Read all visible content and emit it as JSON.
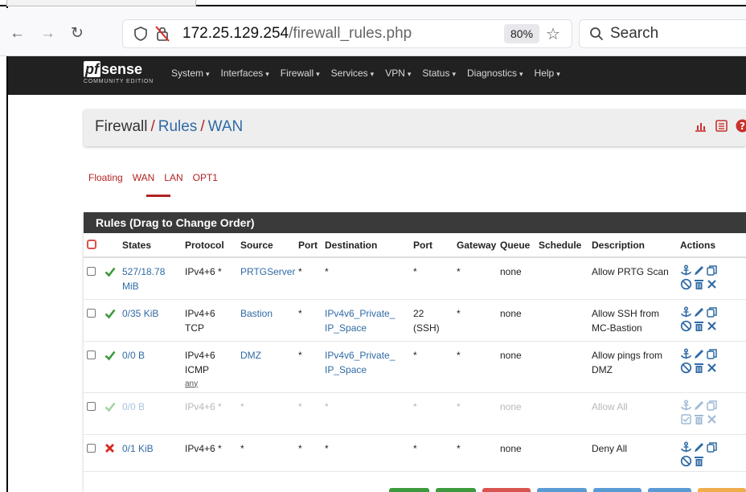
{
  "browser": {
    "url_host": "172.25.129.254",
    "url_path": "/firewall_rules.php",
    "zoom": "80%",
    "search_placeholder": "Search"
  },
  "navbar": {
    "logo_pf": "pf",
    "logo_sense": "sense",
    "logo_edition": "COMMUNITY EDITION",
    "menu": [
      "System",
      "Interfaces",
      "Firewall",
      "Services",
      "VPN",
      "Status",
      "Diagnostics",
      "Help"
    ]
  },
  "breadcrumb": {
    "root": "Firewall",
    "sep1": "/",
    "level2": "Rules",
    "sep2": "/",
    "level3": "WAN"
  },
  "subtabs": [
    "Floating",
    "WAN",
    "LAN",
    "OPT1"
  ],
  "rules": {
    "title": "Rules (Drag to Change Order)",
    "headers": {
      "states": "States",
      "protocol": "Protocol",
      "source": "Source",
      "port": "Port",
      "destination": "Destination",
      "dport": "Port",
      "gateway": "Gateway",
      "queue": "Queue",
      "schedule": "Schedule",
      "description": "Description",
      "actions": "Actions"
    },
    "rows": [
      {
        "states1": "527/18.78",
        "states2": "MiB",
        "proto1": "IPv4+6 *",
        "proto2": "",
        "source": "PRTGServer",
        "sport": "*",
        "dest1": "*",
        "dest2": "",
        "dport1": "*",
        "dport2": "",
        "gateway": "*",
        "queue": "none",
        "schedule": "",
        "desc1": "Allow PRTG Scan",
        "desc2": ""
      },
      {
        "states1": "0/35 KiB",
        "states2": "",
        "proto1": "IPv4+6",
        "proto2": "TCP",
        "source": "Bastion",
        "sport": "*",
        "dest1": "IPv4v6_Private_",
        "dest2": "IP_Space",
        "dport1": "22",
        "dport2": "(SSH)",
        "gateway": "*",
        "queue": "none",
        "schedule": "",
        "desc1": "Allow SSH from",
        "desc2": "MC-Bastion"
      },
      {
        "states1": "0/0 B",
        "states2": "",
        "proto1": "IPv4+6",
        "proto2": "ICMP",
        "proto3": "any",
        "source": "DMZ",
        "sport": "*",
        "dest1": "IPv4v6_Private_",
        "dest2": "IP_Space",
        "dport1": "*",
        "dport2": "",
        "gateway": "*",
        "queue": "none",
        "schedule": "",
        "desc1": "Allow pings from",
        "desc2": "DMZ"
      },
      {
        "states1": "0/0 B",
        "states2": "",
        "proto1": "IPv4+6 *",
        "proto2": "",
        "source": "*",
        "sport": "*",
        "dest1": "*",
        "dest2": "",
        "dport1": "*",
        "dport2": "",
        "gateway": "*",
        "queue": "none",
        "schedule": "",
        "desc1": "Allow All",
        "desc2": ""
      },
      {
        "states1": "0/1 KiB",
        "states2": "",
        "proto1": "IPv4+6 *",
        "proto2": "",
        "source": "*",
        "sport": "*",
        "dest1": "*",
        "dest2": "",
        "dport1": "*",
        "dport2": "",
        "gateway": "*",
        "queue": "none",
        "schedule": "",
        "desc1": "Deny All",
        "desc2": ""
      }
    ]
  },
  "colors": {
    "navbar": "#212121",
    "accent_red": "#b22222",
    "link_blue": "#2f6aa5",
    "pass_green": "#3c9a3c",
    "block_red": "#d9281f"
  }
}
